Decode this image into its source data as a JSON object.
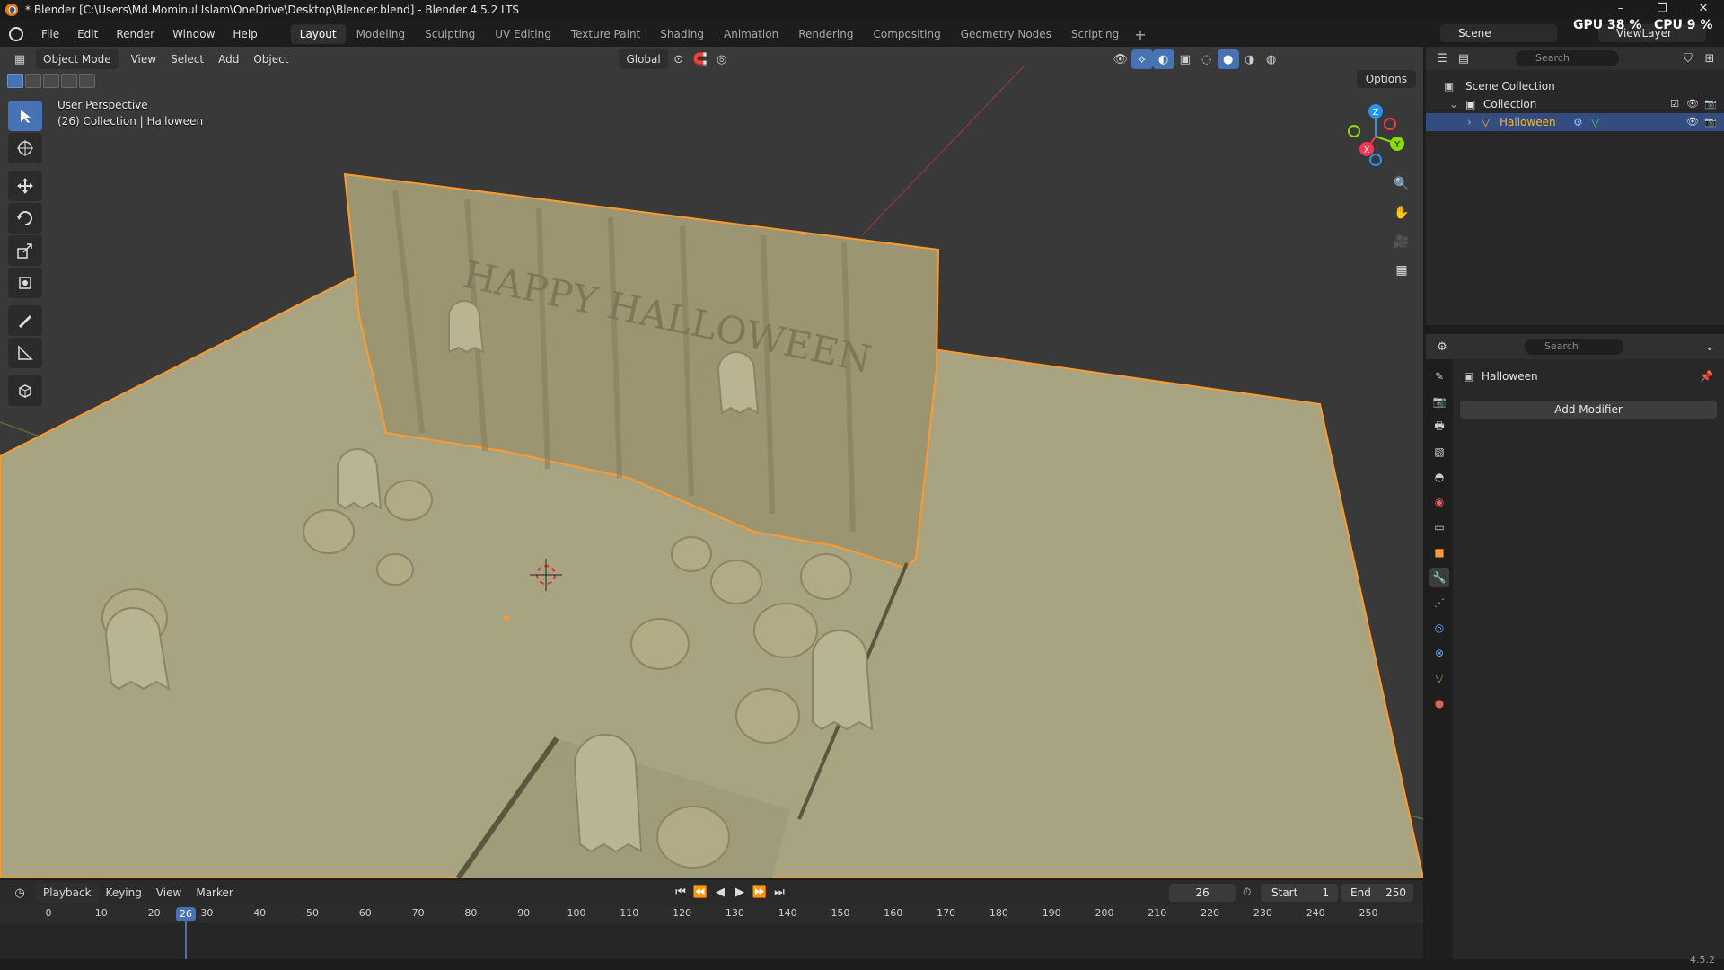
{
  "window": {
    "title": "* Blender [C:\\Users\\Md.Mominul Islam\\OneDrive\\Desktop\\Blender.blend] - Blender 4.5.2 LTS",
    "min": "–",
    "max": "❐",
    "close": "✕"
  },
  "menu": [
    "File",
    "Edit",
    "Render",
    "Window",
    "Help"
  ],
  "workspaces": [
    "Layout",
    "Modeling",
    "Sculpting",
    "UV Editing",
    "Texture Paint",
    "Shading",
    "Animation",
    "Rendering",
    "Compositing",
    "Geometry Nodes",
    "Scripting"
  ],
  "active_workspace": "Layout",
  "scene": "Scene",
  "view_layer": "ViewLayer",
  "gpu": {
    "label": "GPU",
    "value": "38 %"
  },
  "cpu": {
    "label": "CPU",
    "value": "9 %"
  },
  "viewport": {
    "mode": "Object Mode",
    "menus": [
      "View",
      "Select",
      "Add",
      "Object"
    ],
    "transform_orientation": "Global",
    "options": "Options",
    "info_line1": "User Perspective",
    "info_line2": "(26) Collection | Halloween",
    "scene_text": "HAPPY HALLOWEEN",
    "gizmo_axes": {
      "x": "X",
      "y": "Y",
      "z": "Z"
    }
  },
  "outliner": {
    "search_placeholder": "Search",
    "scene_collection": "Scene Collection",
    "collection": "Collection",
    "object": "Halloween"
  },
  "properties": {
    "search_placeholder": "Search",
    "object_name": "Halloween",
    "add_modifier": "Add Modifier"
  },
  "timeline": {
    "menus": [
      "Playback",
      "Keying",
      "View",
      "Marker"
    ],
    "current_frame": "26",
    "start_label": "Start",
    "start": "1",
    "end_label": "End",
    "end": "250",
    "ticks": [
      "0",
      "10",
      "20",
      "30",
      "40",
      "50",
      "60",
      "70",
      "80",
      "90",
      "100",
      "110",
      "120",
      "130",
      "140",
      "150",
      "160",
      "170",
      "180",
      "190",
      "200",
      "210",
      "220",
      "230",
      "240",
      "250"
    ]
  },
  "version": "4.5.2",
  "colors": {
    "accent": "#4772b3",
    "selection": "#ff9b2e",
    "model": "#b5b08c",
    "x_axis": "#ff3352",
    "y_axis": "#8bdc00",
    "z_axis": "#2890ff"
  }
}
